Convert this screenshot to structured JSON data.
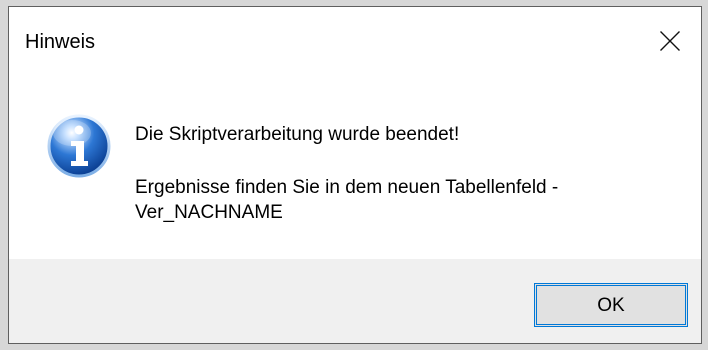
{
  "dialog": {
    "title": "Hinweis",
    "close_icon": "close-icon",
    "info_icon": "information-icon",
    "message_line_1": "Die Skriptverarbeitung wurde beendet!",
    "message_line_2": "Ergebnisse finden Sie in dem neuen Tabellenfeld - Ver_NACHNAME",
    "ok_label": "OK"
  },
  "colors": {
    "dialog_background": "#ffffff",
    "footer_background": "#f0f0f0",
    "button_border": "#0078d7",
    "info_icon_blue": "#1f5fb8"
  }
}
